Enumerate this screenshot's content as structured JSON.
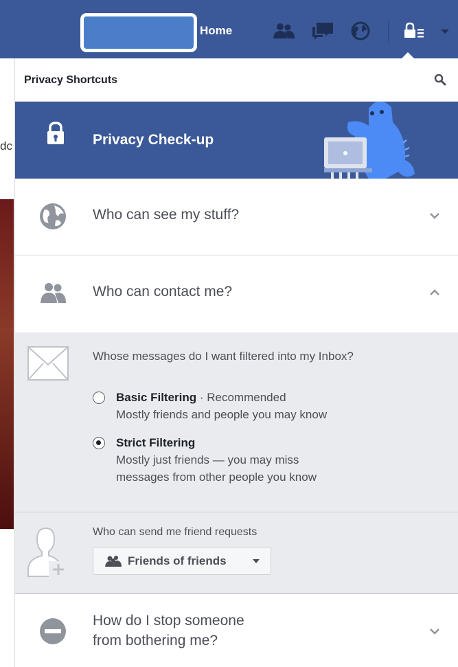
{
  "topbar": {
    "home_label": "Home",
    "icons": [
      "friend-requests-icon",
      "messages-icon",
      "notifications-globe-icon",
      "privacy-shortcuts-icon",
      "account-menu-caret-icon"
    ],
    "brand_color": "#3b5998"
  },
  "background": {
    "fragment_text": "dc"
  },
  "panel": {
    "title": "Privacy Shortcuts",
    "checkup_label": "Privacy Check-up",
    "rows": [
      {
        "label": "Who can see my stuff?",
        "icon": "globe-icon",
        "state": "collapsed"
      },
      {
        "label": "Who can contact me?",
        "icon": "people-icon",
        "state": "expanded"
      }
    ],
    "messages": {
      "question": "Whose messages do I want filtered into my Inbox?",
      "options": [
        {
          "title": "Basic Filtering",
          "suffix": " · Recommended",
          "desc": "Mostly friends and people you may know",
          "selected": false
        },
        {
          "title": "Strict Filtering",
          "suffix": "",
          "desc1": "Mostly just friends — you may miss",
          "desc2": "messages from other people you know",
          "selected": true
        }
      ]
    },
    "friend_requests": {
      "label": "Who can send me friend requests",
      "selected": "Friends of friends"
    },
    "stop_row": {
      "line1": "How do I stop someone",
      "line2": "from bothering me?"
    }
  }
}
